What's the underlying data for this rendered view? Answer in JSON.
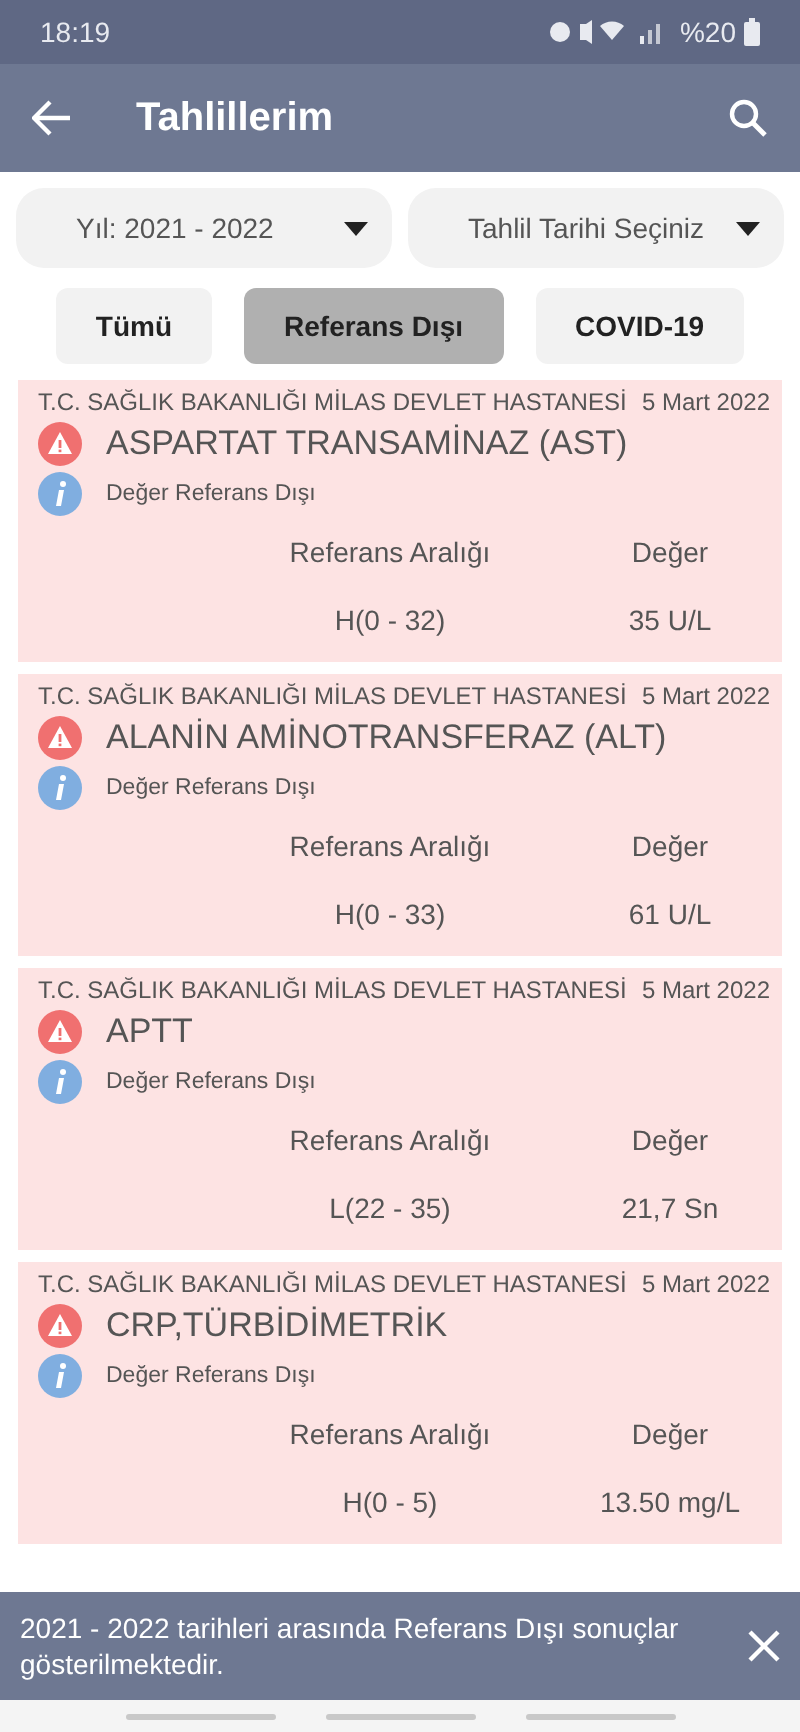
{
  "status_bar": {
    "time": "18:19",
    "battery": "%20"
  },
  "app_bar": {
    "title": "Tahlillerim"
  },
  "filters": [
    {
      "label": "Yıl: 2021 - 2022"
    },
    {
      "label": "Tahlil Tarihi Seçiniz"
    }
  ],
  "tabs": [
    {
      "label": "Tümü",
      "selected": false
    },
    {
      "label": "Referans Dışı",
      "selected": true
    },
    {
      "label": "COVID-19",
      "selected": false
    }
  ],
  "results": [
    {
      "hospital": "T.C. SAĞLIK BAKANLIĞI MİLAS DEVLET HASTANESİ",
      "date": "5 Mart 2022",
      "test": "ASPARTAT TRANSAMİNAZ (AST)",
      "status": "Değer Referans Dışı",
      "range_label": "Referans Aralığı",
      "value_label": "Değer",
      "range": "H(0 - 32)",
      "value": "35 U/L"
    },
    {
      "hospital": "T.C. SAĞLIK BAKANLIĞI MİLAS DEVLET HASTANESİ",
      "date": "5 Mart 2022",
      "test": "ALANİN AMİNOTRANSFERAZ (ALT)",
      "status": "Değer Referans Dışı",
      "range_label": "Referans Aralığı",
      "value_label": "Değer",
      "range": "H(0 - 33)",
      "value": "61 U/L"
    },
    {
      "hospital": "T.C. SAĞLIK BAKANLIĞI MİLAS DEVLET HASTANESİ",
      "date": "5 Mart 2022",
      "test": "APTT",
      "status": "Değer Referans Dışı",
      "range_label": "Referans Aralığı",
      "value_label": "Değer",
      "range": "L(22 - 35)",
      "value": "21,7 Sn"
    },
    {
      "hospital": "T.C. SAĞLIK BAKANLIĞI MİLAS DEVLET HASTANESİ",
      "date": "5 Mart 2022",
      "test": "CRP,TÜRBİDİMETRİK",
      "status": "Değer Referans Dışı",
      "range_label": "Referans Aralığı",
      "value_label": "Değer",
      "range": "H(0 - 5)",
      "value": "13.50 mg/L"
    }
  ],
  "snackbar": {
    "message": "2021 - 2022 tarihleri arasında Referans Dışı sonuçlar gösterilmektedir."
  }
}
